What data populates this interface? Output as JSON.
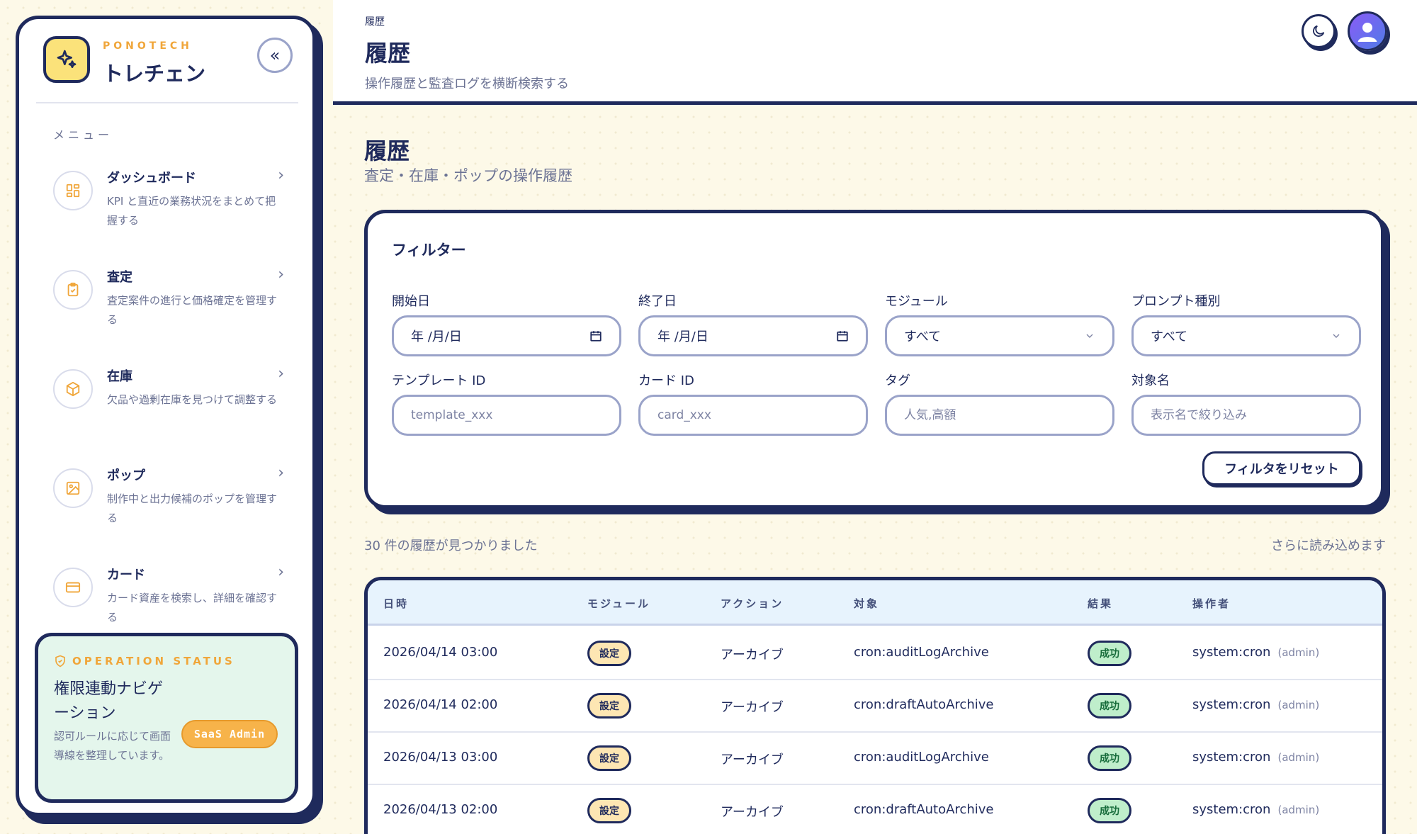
{
  "brand": {
    "kicker": "PONOTECH",
    "name": "トレチェン",
    "collapse": "«"
  },
  "menu": {
    "heading": "メニュー",
    "items": [
      {
        "title": "ダッシュボード",
        "desc": "KPI と直近の業務状況をまとめて把握する",
        "icon": "dashboard-grid-icon"
      },
      {
        "title": "査定",
        "desc": "査定案件の進行と価格確定を管理する",
        "icon": "clipboard-check-icon"
      },
      {
        "title": "在庫",
        "desc": "欠品や過剰在庫を見つけて調整する",
        "icon": "box-icon"
      },
      {
        "title": "ポップ",
        "desc": "制作中と出力候補のポップを管理する",
        "icon": "image-icon"
      },
      {
        "title": "カード",
        "desc": "カード資産を検索し、詳細を確認する",
        "icon": "card-icon"
      }
    ]
  },
  "status": {
    "kicker": "OPERATION STATUS",
    "title": "権限連動ナビゲーション",
    "desc": "認可ルールに応じて画面導線を整理しています。",
    "badge": "SaaS Admin"
  },
  "header": {
    "breadcrumb": "履歴",
    "title": "履歴",
    "subtitle": "操作履歴と監査ログを横断検索する"
  },
  "page": {
    "title": "履歴",
    "subtitle": "査定・在庫・ポップの操作履歴"
  },
  "filter": {
    "heading": "フィルター",
    "start_label": "開始日",
    "start_value": "年 /月/日",
    "end_label": "終了日",
    "end_value": "年 /月/日",
    "module_label": "モジュール",
    "module_value": "すべて",
    "prompt_label": "プロンプト種別",
    "prompt_value": "すべて",
    "template_label": "テンプレート ID",
    "template_placeholder": "template_xxx",
    "card_label": "カード ID",
    "card_placeholder": "card_xxx",
    "tag_label": "タグ",
    "tag_placeholder": "人気,高額",
    "target_label": "対象名",
    "target_placeholder": "表示名で絞り込み",
    "reset": "フィルタをリセット"
  },
  "results": {
    "count_text": "30 件の履歴が見つかりました",
    "load_more": "さらに読み込めます"
  },
  "table": {
    "headers": [
      "日時",
      "モジュール",
      "アクション",
      "対象",
      "結果",
      "操作者"
    ],
    "rows": [
      {
        "datetime": "2026/04/14 03:00",
        "module": "設定",
        "action": "アーカイブ",
        "target": "cron:auditLogArchive",
        "result": "成功",
        "operator": "system:cron",
        "role": "(admin)"
      },
      {
        "datetime": "2026/04/14 02:00",
        "module": "設定",
        "action": "アーカイブ",
        "target": "cron:draftAutoArchive",
        "result": "成功",
        "operator": "system:cron",
        "role": "(admin)"
      },
      {
        "datetime": "2026/04/13 03:00",
        "module": "設定",
        "action": "アーカイブ",
        "target": "cron:auditLogArchive",
        "result": "成功",
        "operator": "system:cron",
        "role": "(admin)"
      },
      {
        "datetime": "2026/04/13 02:00",
        "module": "設定",
        "action": "アーカイブ",
        "target": "cron:draftAutoArchive",
        "result": "成功",
        "operator": "system:cron",
        "role": "(admin)"
      }
    ]
  },
  "colors": {
    "navy": "#1f2a5c",
    "accent": "#f0a63a",
    "success": "#bfeecb",
    "module": "#fde6b3"
  }
}
